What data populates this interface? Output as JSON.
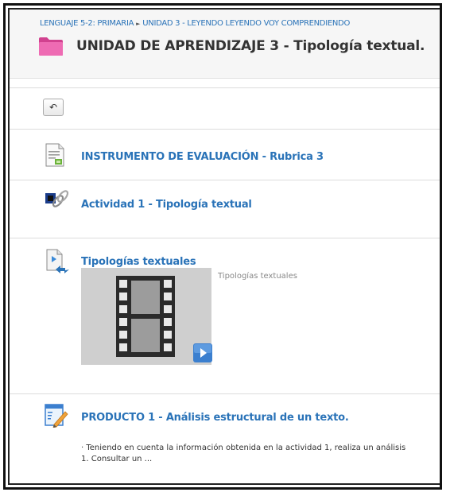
{
  "breadcrumb": {
    "course": "LENGUAJE 5-2: PRIMARIA",
    "separator": "►",
    "current": "UNIDAD 3 - LEYENDO LEYENDO VOY COMPRENDIENDO"
  },
  "page": {
    "title": "UNIDAD DE APRENDIZAJE 3 - Tipología textual."
  },
  "toolbar": {
    "back_symbol": "↶"
  },
  "activities": [
    {
      "title": "INSTRUMENTO DE EVALUACIÓN - Rubrica 3",
      "icon": "document-icon"
    },
    {
      "title": "Actividad 1 - Tipología textual",
      "icon": "link-icon"
    },
    {
      "title": "Tipologías textuales",
      "icon": "video-resource-icon",
      "caption": "Tipologías textuales"
    },
    {
      "title": "PRODUCTO 1 - Análisis estructural de un texto.",
      "icon": "assignment-icon",
      "description_line1": "· Teniendo en cuenta la información obtenida en la actividad 1, realiza un análisis",
      "description_line2": "1. Consultar un ..."
    }
  ],
  "colors": {
    "link": "#2a73b8",
    "folder": "#e85aa8",
    "header_bg": "#f6f6f6"
  }
}
